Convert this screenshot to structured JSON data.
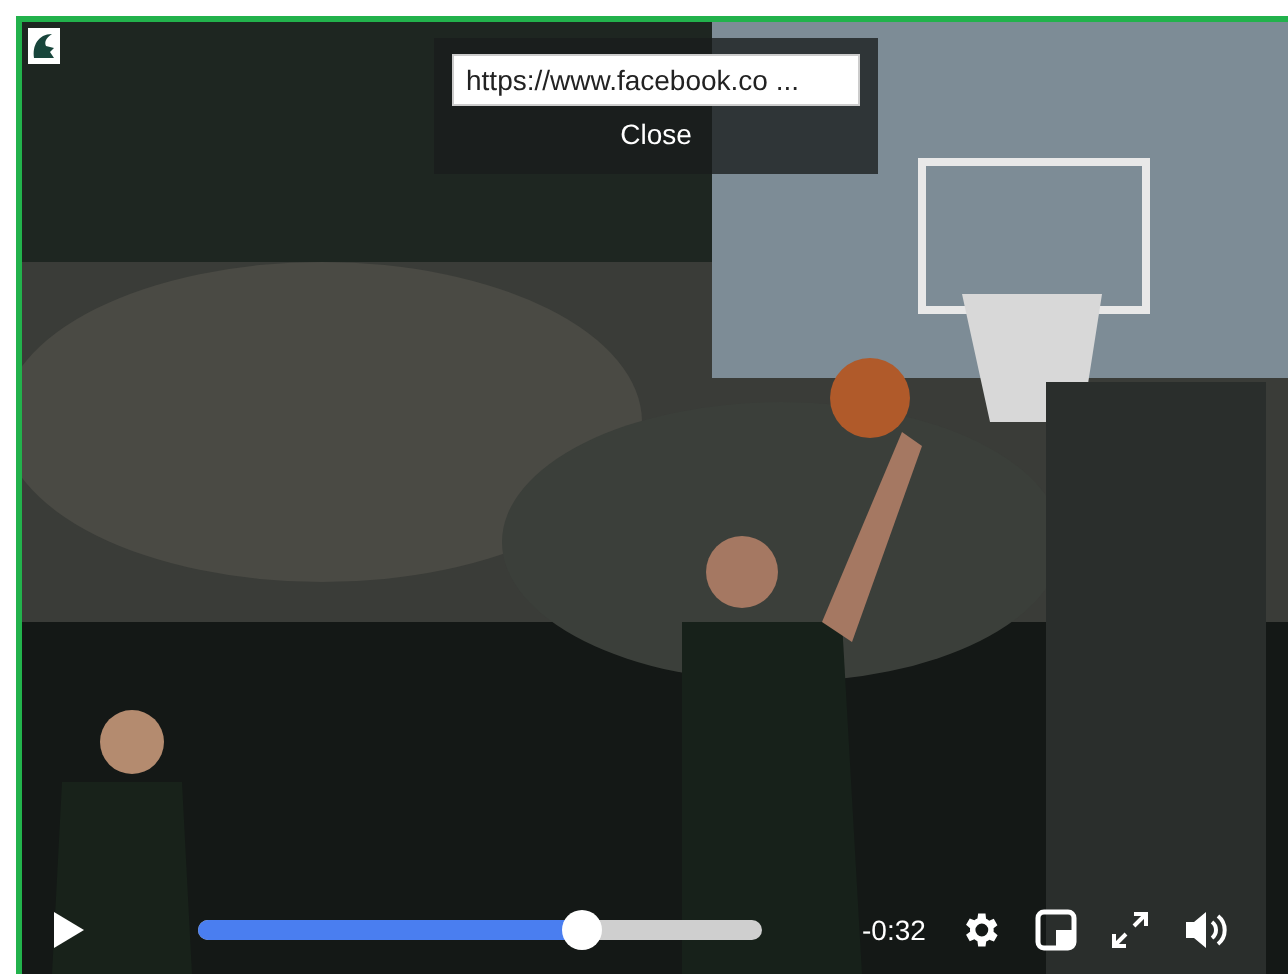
{
  "share_popup": {
    "url": "https://www.facebook.co  ...",
    "close": "Close"
  },
  "controls": {
    "playing": false,
    "progress": {
      "level": 0.68
    },
    "time": "-0:32"
  }
}
